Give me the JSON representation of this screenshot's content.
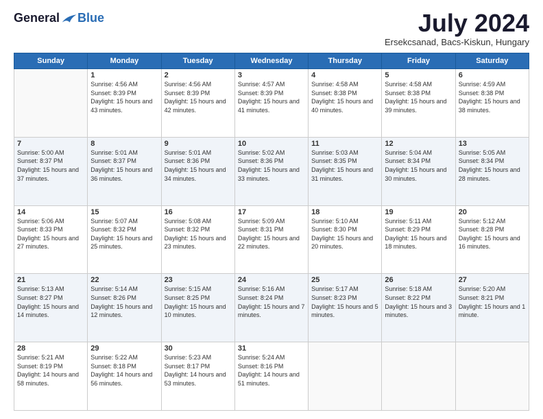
{
  "logo": {
    "general": "General",
    "blue": "Blue"
  },
  "header": {
    "month": "July 2024",
    "location": "Ersekcsanad, Bacs-Kiskun, Hungary"
  },
  "weekdays": [
    "Sunday",
    "Monday",
    "Tuesday",
    "Wednesday",
    "Thursday",
    "Friday",
    "Saturday"
  ],
  "weeks": [
    [
      {
        "day": "",
        "sunrise": "",
        "sunset": "",
        "daylight": ""
      },
      {
        "day": "1",
        "sunrise": "Sunrise: 4:56 AM",
        "sunset": "Sunset: 8:39 PM",
        "daylight": "Daylight: 15 hours and 43 minutes."
      },
      {
        "day": "2",
        "sunrise": "Sunrise: 4:56 AM",
        "sunset": "Sunset: 8:39 PM",
        "daylight": "Daylight: 15 hours and 42 minutes."
      },
      {
        "day": "3",
        "sunrise": "Sunrise: 4:57 AM",
        "sunset": "Sunset: 8:39 PM",
        "daylight": "Daylight: 15 hours and 41 minutes."
      },
      {
        "day": "4",
        "sunrise": "Sunrise: 4:58 AM",
        "sunset": "Sunset: 8:38 PM",
        "daylight": "Daylight: 15 hours and 40 minutes."
      },
      {
        "day": "5",
        "sunrise": "Sunrise: 4:58 AM",
        "sunset": "Sunset: 8:38 PM",
        "daylight": "Daylight: 15 hours and 39 minutes."
      },
      {
        "day": "6",
        "sunrise": "Sunrise: 4:59 AM",
        "sunset": "Sunset: 8:38 PM",
        "daylight": "Daylight: 15 hours and 38 minutes."
      }
    ],
    [
      {
        "day": "7",
        "sunrise": "Sunrise: 5:00 AM",
        "sunset": "Sunset: 8:37 PM",
        "daylight": "Daylight: 15 hours and 37 minutes."
      },
      {
        "day": "8",
        "sunrise": "Sunrise: 5:01 AM",
        "sunset": "Sunset: 8:37 PM",
        "daylight": "Daylight: 15 hours and 36 minutes."
      },
      {
        "day": "9",
        "sunrise": "Sunrise: 5:01 AM",
        "sunset": "Sunset: 8:36 PM",
        "daylight": "Daylight: 15 hours and 34 minutes."
      },
      {
        "day": "10",
        "sunrise": "Sunrise: 5:02 AM",
        "sunset": "Sunset: 8:36 PM",
        "daylight": "Daylight: 15 hours and 33 minutes."
      },
      {
        "day": "11",
        "sunrise": "Sunrise: 5:03 AM",
        "sunset": "Sunset: 8:35 PM",
        "daylight": "Daylight: 15 hours and 31 minutes."
      },
      {
        "day": "12",
        "sunrise": "Sunrise: 5:04 AM",
        "sunset": "Sunset: 8:34 PM",
        "daylight": "Daylight: 15 hours and 30 minutes."
      },
      {
        "day": "13",
        "sunrise": "Sunrise: 5:05 AM",
        "sunset": "Sunset: 8:34 PM",
        "daylight": "Daylight: 15 hours and 28 minutes."
      }
    ],
    [
      {
        "day": "14",
        "sunrise": "Sunrise: 5:06 AM",
        "sunset": "Sunset: 8:33 PM",
        "daylight": "Daylight: 15 hours and 27 minutes."
      },
      {
        "day": "15",
        "sunrise": "Sunrise: 5:07 AM",
        "sunset": "Sunset: 8:32 PM",
        "daylight": "Daylight: 15 hours and 25 minutes."
      },
      {
        "day": "16",
        "sunrise": "Sunrise: 5:08 AM",
        "sunset": "Sunset: 8:32 PM",
        "daylight": "Daylight: 15 hours and 23 minutes."
      },
      {
        "day": "17",
        "sunrise": "Sunrise: 5:09 AM",
        "sunset": "Sunset: 8:31 PM",
        "daylight": "Daylight: 15 hours and 22 minutes."
      },
      {
        "day": "18",
        "sunrise": "Sunrise: 5:10 AM",
        "sunset": "Sunset: 8:30 PM",
        "daylight": "Daylight: 15 hours and 20 minutes."
      },
      {
        "day": "19",
        "sunrise": "Sunrise: 5:11 AM",
        "sunset": "Sunset: 8:29 PM",
        "daylight": "Daylight: 15 hours and 18 minutes."
      },
      {
        "day": "20",
        "sunrise": "Sunrise: 5:12 AM",
        "sunset": "Sunset: 8:28 PM",
        "daylight": "Daylight: 15 hours and 16 minutes."
      }
    ],
    [
      {
        "day": "21",
        "sunrise": "Sunrise: 5:13 AM",
        "sunset": "Sunset: 8:27 PM",
        "daylight": "Daylight: 15 hours and 14 minutes."
      },
      {
        "day": "22",
        "sunrise": "Sunrise: 5:14 AM",
        "sunset": "Sunset: 8:26 PM",
        "daylight": "Daylight: 15 hours and 12 minutes."
      },
      {
        "day": "23",
        "sunrise": "Sunrise: 5:15 AM",
        "sunset": "Sunset: 8:25 PM",
        "daylight": "Daylight: 15 hours and 10 minutes."
      },
      {
        "day": "24",
        "sunrise": "Sunrise: 5:16 AM",
        "sunset": "Sunset: 8:24 PM",
        "daylight": "Daylight: 15 hours and 7 minutes."
      },
      {
        "day": "25",
        "sunrise": "Sunrise: 5:17 AM",
        "sunset": "Sunset: 8:23 PM",
        "daylight": "Daylight: 15 hours and 5 minutes."
      },
      {
        "day": "26",
        "sunrise": "Sunrise: 5:18 AM",
        "sunset": "Sunset: 8:22 PM",
        "daylight": "Daylight: 15 hours and 3 minutes."
      },
      {
        "day": "27",
        "sunrise": "Sunrise: 5:20 AM",
        "sunset": "Sunset: 8:21 PM",
        "daylight": "Daylight: 15 hours and 1 minute."
      }
    ],
    [
      {
        "day": "28",
        "sunrise": "Sunrise: 5:21 AM",
        "sunset": "Sunset: 8:19 PM",
        "daylight": "Daylight: 14 hours and 58 minutes."
      },
      {
        "day": "29",
        "sunrise": "Sunrise: 5:22 AM",
        "sunset": "Sunset: 8:18 PM",
        "daylight": "Daylight: 14 hours and 56 minutes."
      },
      {
        "day": "30",
        "sunrise": "Sunrise: 5:23 AM",
        "sunset": "Sunset: 8:17 PM",
        "daylight": "Daylight: 14 hours and 53 minutes."
      },
      {
        "day": "31",
        "sunrise": "Sunrise: 5:24 AM",
        "sunset": "Sunset: 8:16 PM",
        "daylight": "Daylight: 14 hours and 51 minutes."
      },
      {
        "day": "",
        "sunrise": "",
        "sunset": "",
        "daylight": ""
      },
      {
        "day": "",
        "sunrise": "",
        "sunset": "",
        "daylight": ""
      },
      {
        "day": "",
        "sunrise": "",
        "sunset": "",
        "daylight": ""
      }
    ]
  ]
}
